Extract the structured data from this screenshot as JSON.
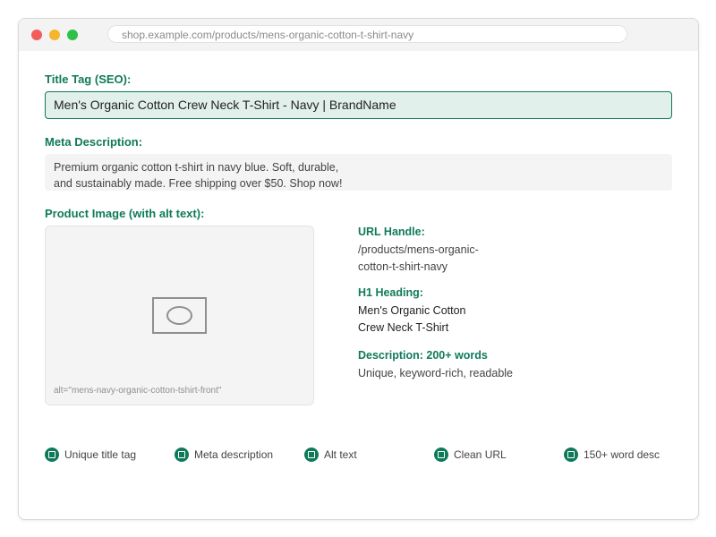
{
  "browser": {
    "url": "shop.example.com/products/mens-organic-cotton-t-shirt-navy",
    "dots": {
      "red": "#f25c5c",
      "yellow": "#f5b52d",
      "green": "#2fc04a"
    }
  },
  "seo": {
    "title_label": "Title Tag (SEO):",
    "title_value": "Men's Organic Cotton Crew Neck T-Shirt - Navy | BrandName",
    "meta_label": "Meta Description:",
    "meta_lines": [
      "Premium organic cotton t-shirt in navy blue. Soft, durable,",
      "and sustainably made. Free shipping over $50. Shop now!"
    ],
    "image_label": "Product Image (with alt text):",
    "image_alt": "alt=\"mens-navy-organic-cotton-tshirt-front\""
  },
  "info": {
    "url_label": "URL Handle:",
    "url_lines": [
      "/products/mens-organic-",
      "cotton-t-shirt-navy"
    ],
    "h1_label": "H1 Heading:",
    "h1_lines": [
      "Men's Organic Cotton",
      "Crew Neck T-Shirt"
    ],
    "desc_label": "Description: 200+ words",
    "desc_value": "Unique, keyword-rich, readable"
  },
  "checklist": [
    {
      "label": "Unique title tag",
      "icon": "check-icon"
    },
    {
      "label": "Meta description",
      "icon": "check-icon"
    },
    {
      "label": "Alt text",
      "icon": "check-icon"
    },
    {
      "label": "Clean URL",
      "icon": "check-icon"
    },
    {
      "label": "150+ word desc",
      "icon": "check-icon"
    }
  ],
  "colors": {
    "accent": "#0f7a5a",
    "title_field_bg": "#e1f0ea",
    "meta_field_bg": "#f4f4f4"
  }
}
